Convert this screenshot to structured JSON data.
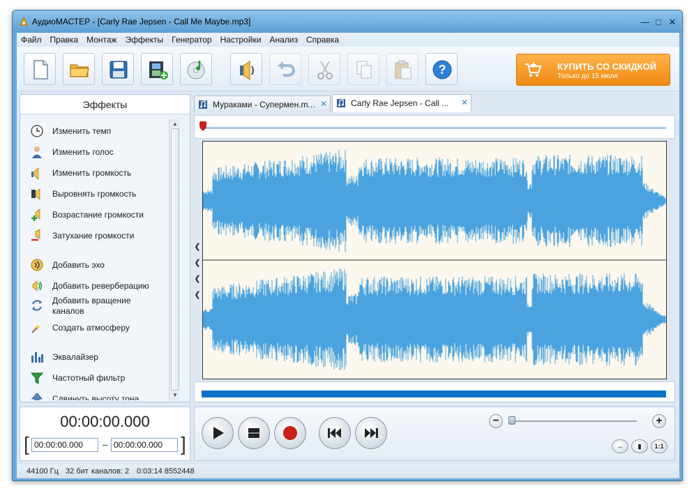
{
  "window": {
    "title": "АудиоМАСТЕР - [Carly Rae Jepsen - Call Me Maybe.mp3]",
    "controls": [
      "minimize-icon",
      "maximize-icon",
      "close-icon"
    ]
  },
  "menu": [
    "Файл",
    "Правка",
    "Монтаж",
    "Эффекты",
    "Генератор",
    "Настройки",
    "Анализ",
    "Справка"
  ],
  "toolbar": {
    "buttons": [
      "new-file-icon",
      "open-folder-icon",
      "save-icon",
      "add-video-icon",
      "cd-music-icon",
      "volume-icon",
      "undo-icon",
      "cut-icon",
      "copy-icon",
      "paste-icon",
      "help-icon"
    ],
    "buy": {
      "title": "КУПИТЬ СО СКИДКОЙ",
      "subtitle": "Только до 15 июля",
      "color": "#f39a24"
    }
  },
  "effects": {
    "header": "Эффекты",
    "items": [
      {
        "label": "Изменить темп",
        "icon": "clock-icon"
      },
      {
        "label": "Изменить голос",
        "icon": "person-icon"
      },
      {
        "label": "Изменить громкость",
        "icon": "volume-bar-icon"
      },
      {
        "label": "Выровнять громкость",
        "icon": "speaker-icon"
      },
      {
        "label": "Возрастание громкости",
        "icon": "volume-plus-icon"
      },
      {
        "label": "Затухание громкости",
        "icon": "volume-minus-icon"
      },
      {
        "label": "Добавить эхо",
        "icon": "echo-icon"
      },
      {
        "label": "Добавить реверберацию",
        "icon": "reverb-icon"
      },
      {
        "label": "Добавить вращение\nканалов",
        "icon": "rotate-icon"
      },
      {
        "label": "Создать атмосферу",
        "icon": "atmosphere-icon"
      },
      {
        "label": "Эквалайзер",
        "icon": "equalizer-icon"
      },
      {
        "label": "Частотный фильтр",
        "icon": "filter-icon"
      },
      {
        "label": "Сдвинуть высоту тона",
        "icon": "pitch-icon"
      }
    ]
  },
  "tabs": [
    {
      "label": "Мураками - Супермен.m...",
      "active": false
    },
    {
      "label": "Carly Rae Jepsen - Call ...",
      "active": true
    }
  ],
  "time": {
    "current": "00:00:00.000",
    "start": "00:00:00.000",
    "end": "00:00:00.000"
  },
  "status": {
    "rate": "44100 Гц",
    "bits": "32 бит",
    "channels": "каналов: 2",
    "duration": "0:03:14 8552448"
  },
  "colors": {
    "waveform": "#4aa3df",
    "waveform_bg": "#fdf8ee",
    "scrollbar": "#0a73c8"
  }
}
